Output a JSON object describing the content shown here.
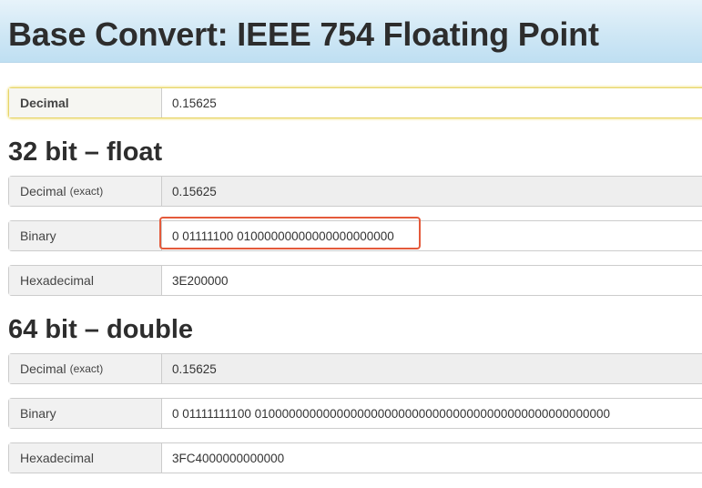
{
  "header": {
    "title": "Base Convert: IEEE 754 Floating Point"
  },
  "input": {
    "label": "Decimal",
    "value": "0.15625"
  },
  "float32": {
    "heading": "32 bit – float",
    "decimal_label": "Decimal",
    "decimal_note": "(exact)",
    "decimal_value": "0.15625",
    "binary_label": "Binary",
    "binary_value": "0 01111100 01000000000000000000000",
    "hex_label": "Hexadecimal",
    "hex_value": "3E200000"
  },
  "float64": {
    "heading": "64 bit – double",
    "decimal_label": "Decimal",
    "decimal_note": "(exact)",
    "decimal_value": "0.15625",
    "binary_label": "Binary",
    "binary_value": "0 01111111100 0100000000000000000000000000000000000000000000000000",
    "hex_label": "Hexadecimal",
    "hex_value": "3FC4000000000000"
  },
  "colors": {
    "header_bg": "#cfe7f5",
    "highlight_border": "#e45a3b",
    "input_focus": "#f3e58c",
    "label_bg": "#f1f1f1"
  }
}
